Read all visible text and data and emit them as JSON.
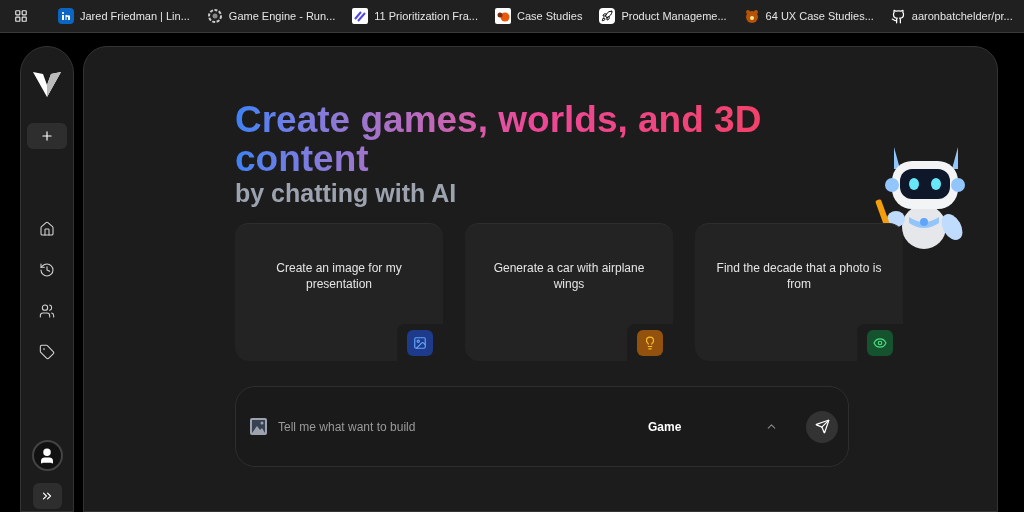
{
  "bookmarks": [
    {
      "kind": "linkedin",
      "label": "Jared Friedman | Lin..."
    },
    {
      "kind": "engine",
      "label": "Game Engine - Run..."
    },
    {
      "kind": "stripes",
      "label": "11 Prioritization Fra..."
    },
    {
      "kind": "orange",
      "label": "Case Studies"
    },
    {
      "kind": "rocket",
      "label": "Product Manageme..."
    },
    {
      "kind": "bear",
      "label": "64 UX Case Studies..."
    },
    {
      "kind": "github",
      "label": "aaronbatchelder/pr..."
    }
  ],
  "sidebar": {
    "nav": [
      {
        "kind": "home",
        "selected": false
      },
      {
        "kind": "history",
        "selected": false
      },
      {
        "kind": "people",
        "selected": false
      },
      {
        "kind": "tag",
        "selected": false
      }
    ]
  },
  "hero": {
    "title": "Create games, worlds, and 3D content",
    "subtitle": "by chatting with AI"
  },
  "suggestions": [
    {
      "text": "Create an image for my presentation",
      "kind": "image",
      "color": "#1e3a8a"
    },
    {
      "text": "Generate a car with airplane wings",
      "kind": "bulb",
      "color": "#92520e"
    },
    {
      "text": "Find the decade that a photo is from",
      "kind": "eye",
      "color": "#14532d"
    }
  ],
  "prompt": {
    "placeholder": "Tell me what want to build",
    "mode": "Game"
  }
}
